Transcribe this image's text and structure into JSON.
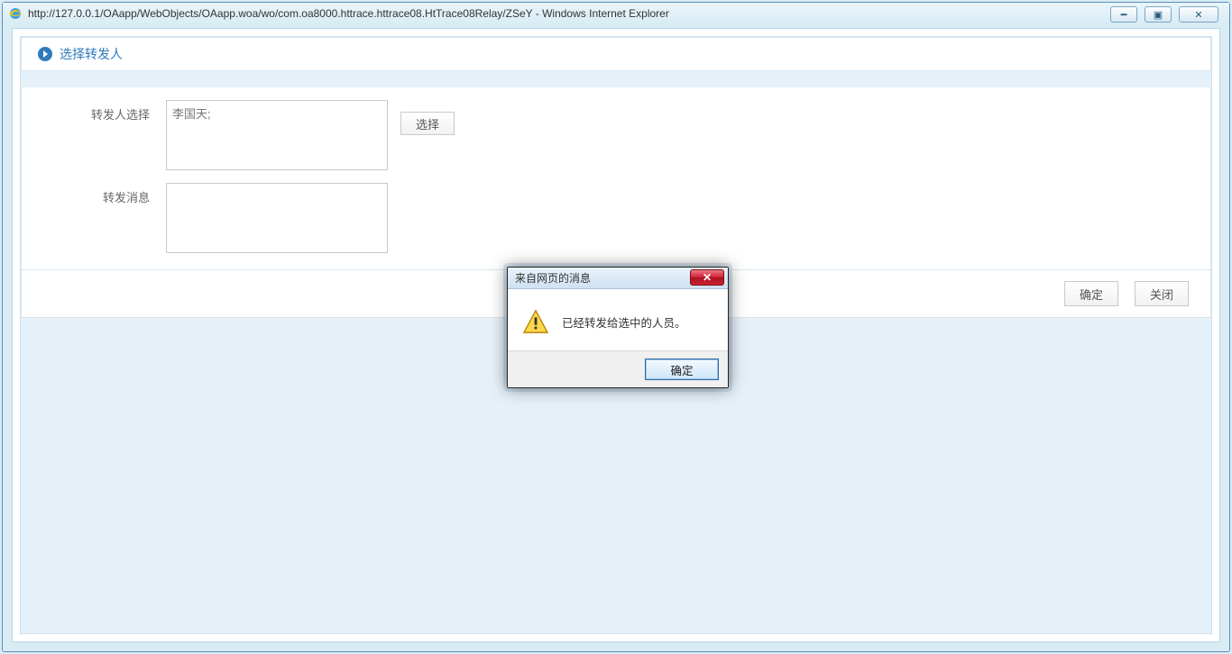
{
  "window": {
    "title_url": "http://127.0.0.1/OAapp/WebObjects/OAapp.woa/wo/com.oa8000.httrace.httrace08.HtTrace08Relay/ZSeY - Windows Internet Explorer"
  },
  "panel": {
    "title": "选择转发人"
  },
  "form": {
    "forwarder_label": "转发人选择",
    "forwarder_value": "李国天;",
    "select_button": "选择",
    "message_label": "转发消息",
    "message_value": ""
  },
  "footer": {
    "ok": "确定",
    "close": "关闭"
  },
  "dialog": {
    "title": "来自网页的消息",
    "body": "已经转发给选中的人员。",
    "ok": "确定"
  }
}
